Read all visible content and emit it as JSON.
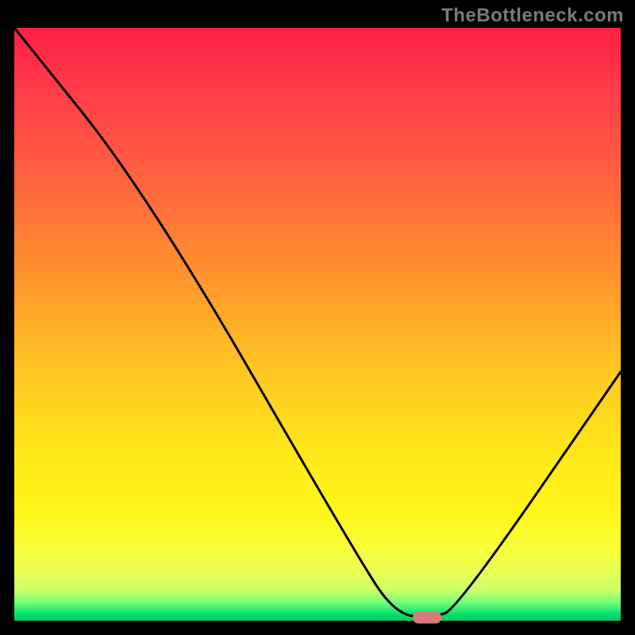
{
  "watermark": "TheBottleneck.com",
  "chart_data": {
    "type": "line",
    "title": "",
    "xlabel": "",
    "ylabel": "",
    "x_range": [
      0,
      100
    ],
    "y_range": [
      0,
      100
    ],
    "curve_points": [
      {
        "x": 0,
        "y": 100
      },
      {
        "x": 22,
        "y": 72
      },
      {
        "x": 57,
        "y": 10
      },
      {
        "x": 63,
        "y": 1
      },
      {
        "x": 69,
        "y": 0.5
      },
      {
        "x": 73,
        "y": 2
      },
      {
        "x": 100,
        "y": 42
      }
    ],
    "marker": {
      "x": 68,
      "y": 0.5
    },
    "gradient_stops": [
      {
        "pos": 0,
        "color": "#ff1f44"
      },
      {
        "pos": 10,
        "color": "#ff3a4a"
      },
      {
        "pos": 28,
        "color": "#ff6a3d"
      },
      {
        "pos": 40,
        "color": "#ff8e2f"
      },
      {
        "pos": 58,
        "color": "#ffc722"
      },
      {
        "pos": 72,
        "color": "#ffe81a"
      },
      {
        "pos": 82,
        "color": "#fff51a"
      },
      {
        "pos": 88,
        "color": "#f8ff3a"
      },
      {
        "pos": 92,
        "color": "#e7ff54"
      },
      {
        "pos": 95,
        "color": "#c8ff6a"
      },
      {
        "pos": 97,
        "color": "#6dff7a"
      },
      {
        "pos": 99,
        "color": "#00e06e"
      },
      {
        "pos": 100,
        "color": "#00c85f"
      }
    ]
  },
  "colors": {
    "frame_bg": "#000000",
    "curve": "#000000",
    "marker": "#d87a7a",
    "watermark": "#7a7a7a"
  }
}
